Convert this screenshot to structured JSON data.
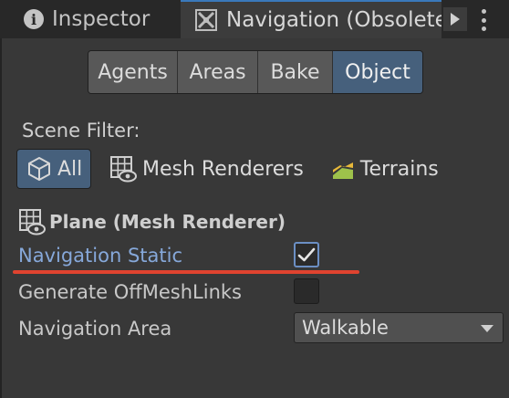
{
  "tabs": {
    "inspector": {
      "label": "Inspector",
      "icon": "info-icon"
    },
    "navigation": {
      "label": "Navigation (Obsolete",
      "icon": "navigation-grid-icon"
    },
    "more_icon": "triangle-right-icon",
    "menu_icon": "kebab-menu-icon"
  },
  "segments": {
    "agents": "Agents",
    "areas": "Areas",
    "bake": "Bake",
    "object": "Object",
    "active": "Object"
  },
  "scene_filter": {
    "label": "Scene Filter:",
    "all": "All",
    "mesh_renderers": "Mesh Renderers",
    "terrains": "Terrains",
    "active": "All"
  },
  "object": {
    "title": "Plane (Mesh Renderer)",
    "navigation_static_label": "Navigation Static",
    "navigation_static_checked": true,
    "generate_offmesh_label": "Generate OffMeshLinks",
    "generate_offmesh_checked": false,
    "navigation_area_label": "Navigation Area",
    "navigation_area_value": "Walkable"
  },
  "colors": {
    "accent": "#46607c",
    "highlight_label": "#86a8da",
    "annotation": "#e0432f",
    "panel": "#383838",
    "tabbar": "#282828"
  }
}
